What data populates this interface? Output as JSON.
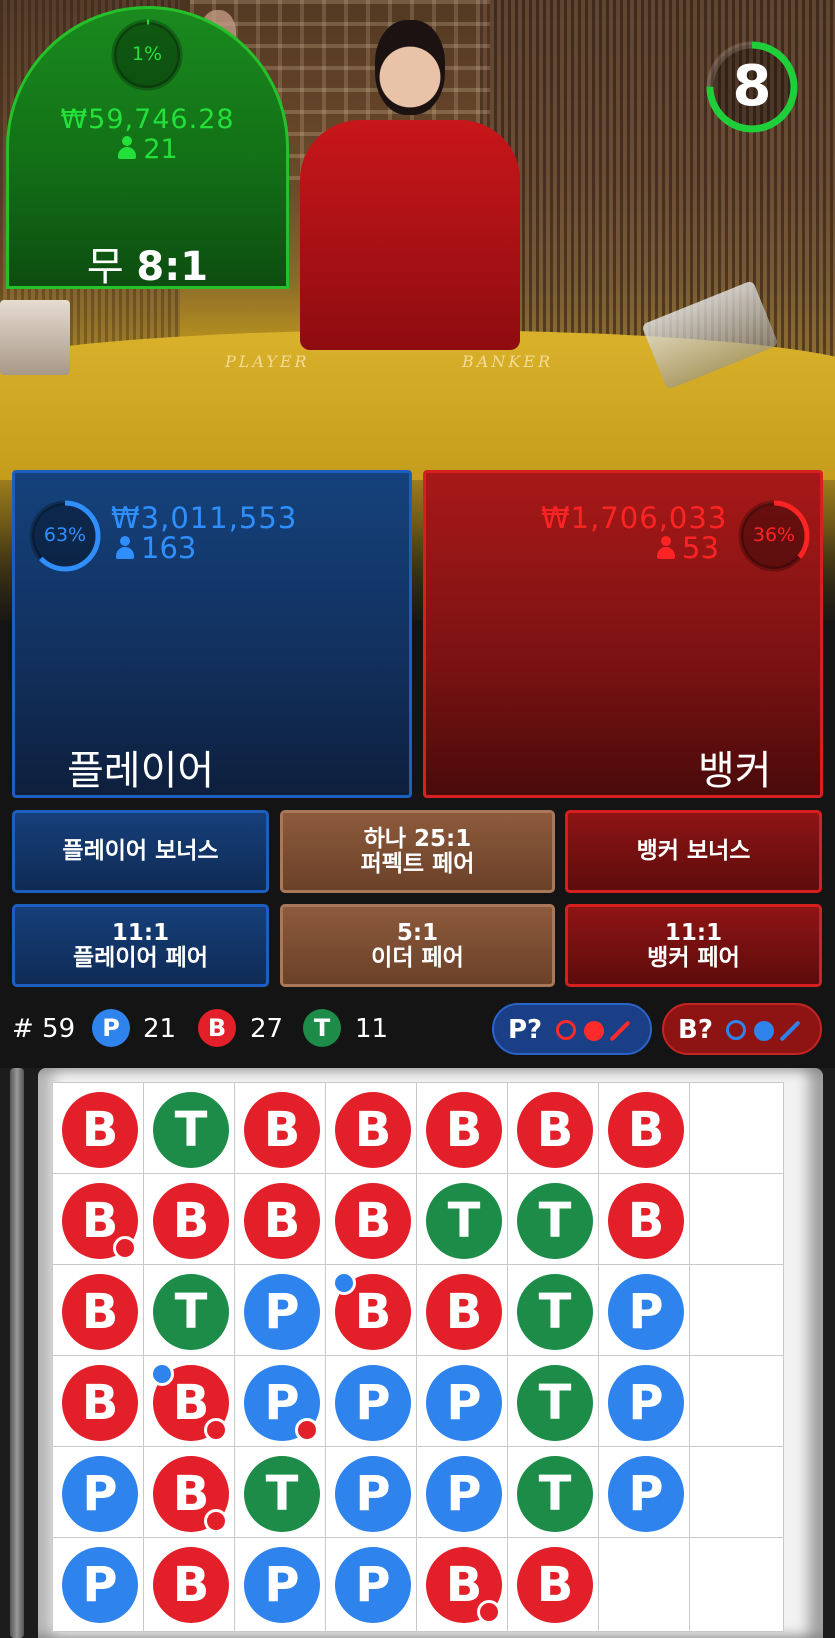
{
  "timer": {
    "value": "8",
    "fraction": 0.75,
    "color": "#1fcf3a"
  },
  "table_labels": {
    "player": "PLAYER",
    "banker": "BANKER"
  },
  "player": {
    "percent_label": "63%",
    "percent": 63,
    "amount": "₩3,011,553",
    "players": "163",
    "label": "플레이어",
    "color": "#2f8fff"
  },
  "tie": {
    "percent_label": "1%",
    "percent": 1,
    "amount": "₩59,746.28",
    "players": "21",
    "label_prefix": "무",
    "label_odds": "8:1",
    "color": "#24e03a"
  },
  "banker": {
    "percent_label": "36%",
    "percent": 36,
    "amount": "₩1,706,033",
    "players": "53",
    "label": "뱅커",
    "color": "#ff2424"
  },
  "side_bets": {
    "player_bonus": "플레이어 보너스",
    "perfect_pair_line1": "하나 25:1",
    "perfect_pair_line2": "퍼펙트 페어",
    "banker_bonus": "뱅커 보너스",
    "player_pair_odds": "11:1",
    "player_pair_label": "플레이어 페어",
    "either_pair_odds": "5:1",
    "either_pair_label": "이더 페어",
    "banker_pair_odds": "11:1",
    "banker_pair_label": "뱅커 페어"
  },
  "stats": {
    "round_label": "# 59",
    "p_badge": "P",
    "p_count": "21",
    "b_badge": "B",
    "b_count": "27",
    "t_badge": "T",
    "t_count": "11"
  },
  "predictions": {
    "player_label": "P?",
    "banker_label": "B?"
  },
  "bead_road": {
    "columns": [
      [
        {
          "r": "B"
        },
        {
          "r": "B",
          "br": "red"
        },
        {
          "r": "B"
        },
        {
          "r": "B"
        },
        {
          "r": "P"
        },
        {
          "r": "P"
        }
      ],
      [
        {
          "r": "T"
        },
        {
          "r": "B"
        },
        {
          "r": "T"
        },
        {
          "r": "B",
          "tl": "blue",
          "br": "red"
        },
        {
          "r": "B",
          "br": "red"
        },
        {
          "r": "B"
        }
      ],
      [
        {
          "r": "B"
        },
        {
          "r": "B"
        },
        {
          "r": "P"
        },
        {
          "r": "P",
          "br": "red"
        },
        {
          "r": "T"
        },
        {
          "r": "P"
        }
      ],
      [
        {
          "r": "B"
        },
        {
          "r": "B"
        },
        {
          "r": "B",
          "tl": "blue"
        },
        {
          "r": "P"
        },
        {
          "r": "P"
        },
        {
          "r": "P"
        }
      ],
      [
        {
          "r": "B"
        },
        {
          "r": "T"
        },
        {
          "r": "B"
        },
        {
          "r": "P"
        },
        {
          "r": "P"
        },
        {
          "r": "B",
          "br": "red"
        }
      ],
      [
        {
          "r": "B"
        },
        {
          "r": "T"
        },
        {
          "r": "T"
        },
        {
          "r": "T"
        },
        {
          "r": "T"
        },
        {
          "r": "B"
        }
      ],
      [
        {
          "r": "B"
        },
        {
          "r": "B"
        },
        {
          "r": "P"
        },
        {
          "r": "P"
        },
        {
          "r": "P"
        }
      ],
      []
    ]
  }
}
